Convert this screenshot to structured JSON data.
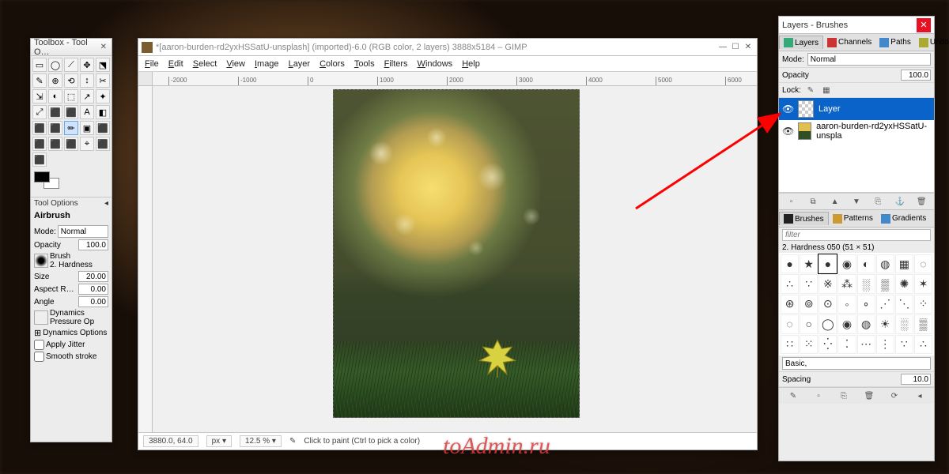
{
  "toolbox": {
    "title": "Toolbox - Tool O…",
    "tools": [
      "▭",
      "◯",
      "⟋",
      "✥",
      "⬔",
      "✎",
      "⊕",
      "⟲",
      "↕",
      "✂",
      "⇲",
      "◐",
      "⬚",
      "↗",
      "✦",
      "⤢",
      "⬛",
      "⬛",
      "A",
      "◧",
      "⬛",
      "⬛",
      "✏",
      "▣",
      "⬛",
      "⬛",
      "⬛",
      "⬛",
      "⌖",
      "⬛",
      "⬛"
    ],
    "tool_options_title": "Tool Options",
    "current_tool": "Airbrush",
    "mode_label": "Mode:",
    "mode_value": "Normal",
    "opacity_label": "Opacity",
    "opacity_value": "100.0",
    "brush_label": "Brush",
    "brush_value": "2. Hardness",
    "size_label": "Size",
    "size_value": "20.00",
    "aspect_label": "Aspect R…",
    "aspect_value": "0.00",
    "angle_label": "Angle",
    "angle_value": "0.00",
    "dynamics_label": "Dynamics",
    "dynamics_value": "Pressure Op",
    "dyn_options": "Dynamics Options",
    "apply_jitter": "Apply Jitter",
    "smooth_stroke": "Smooth stroke"
  },
  "imgwin": {
    "title": "*[aaron-burden-rd2yxHSSatU-unsplash] (imported)-6.0 (RGB color, 2 layers) 3888x5184 – GIMP",
    "menu": [
      "File",
      "Edit",
      "Select",
      "View",
      "Image",
      "Layer",
      "Colors",
      "Tools",
      "Filters",
      "Windows",
      "Help"
    ],
    "ruler_ticks": [
      "-2000",
      "-1000",
      "0",
      "1000",
      "2000",
      "3000",
      "4000",
      "5000",
      "6000"
    ],
    "status_coords": "3880.0, 64.0",
    "status_units": "px",
    "status_zoom": "12.5 %",
    "status_hint": "Click to paint (Ctrl to pick a color)"
  },
  "layers": {
    "title": "Layers - Brushes",
    "tabs": [
      "Layers",
      "Channels",
      "Paths",
      "Undo"
    ],
    "mode_label": "Mode:",
    "mode_value": "Normal",
    "opacity_label": "Opacity",
    "opacity_value": "100.0",
    "lock_label": "Lock:",
    "items": [
      {
        "name": "Layer",
        "selected": true,
        "transparent": true
      },
      {
        "name": "aaron-burden-rd2yxHSSatU-unspla",
        "selected": false,
        "transparent": false
      }
    ],
    "brush_tabs": [
      "Brushes",
      "Patterns",
      "Gradients"
    ],
    "filter_placeholder": "filter",
    "brush_name": "2. Hardness 050 (51 × 51)",
    "brushes": [
      "●",
      "★",
      "●",
      "◉",
      "◐",
      "◍",
      "▦",
      "◌",
      "∴",
      "∵",
      "※",
      "⁂",
      "░",
      "▒",
      "✺",
      "✶",
      "⊛",
      "⊚",
      "⊙",
      "◦",
      "∘",
      "⋰",
      "⋱",
      "⁘",
      "◌",
      "○",
      "◯",
      "◉",
      "◍",
      "☀",
      "░",
      "▒",
      "∷",
      "⁙",
      "⁛",
      "⁚",
      "⋯",
      "⋮",
      "∵",
      "∴"
    ],
    "preset_label": "Basic,",
    "spacing_label": "Spacing",
    "spacing_value": "10.0"
  },
  "watermark": "toAdmin.ru"
}
